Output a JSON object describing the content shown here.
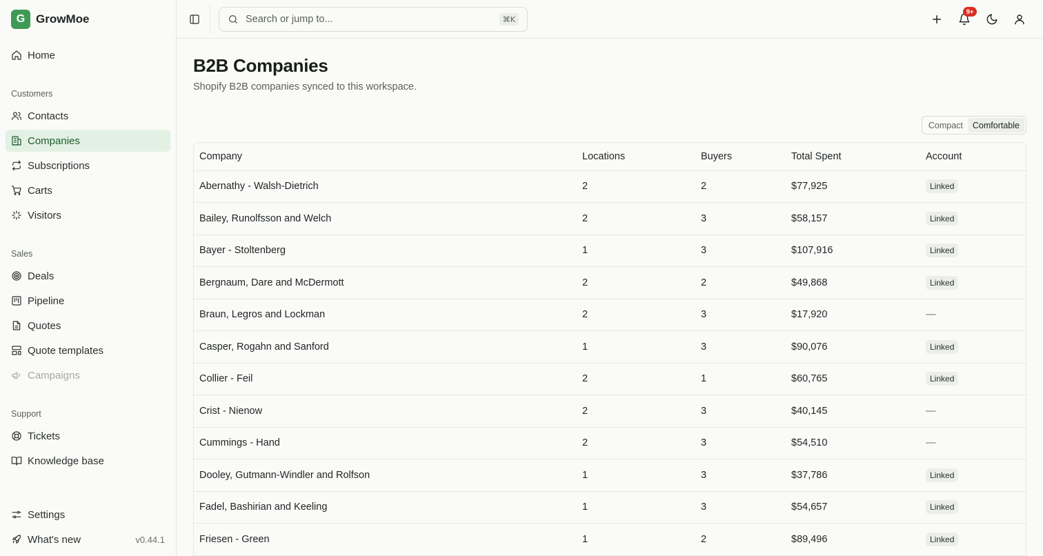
{
  "app": {
    "name": "GrowMoe",
    "logo_letter": "G",
    "version": "v0.44.1"
  },
  "sidebar": {
    "home": "Home",
    "sections": [
      {
        "label": "Customers",
        "items": [
          "Contacts",
          "Companies",
          "Subscriptions",
          "Carts",
          "Visitors"
        ]
      },
      {
        "label": "Sales",
        "items": [
          "Deals",
          "Pipeline",
          "Quotes",
          "Quote templates",
          "Campaigns"
        ]
      },
      {
        "label": "Support",
        "items": [
          "Tickets",
          "Knowledge base"
        ]
      }
    ],
    "active": "Companies",
    "footer": {
      "settings": "Settings",
      "whats_new": "What's new"
    }
  },
  "topbar": {
    "search_placeholder": "Search or jump to...",
    "search_shortcut": "⌘K",
    "notification_badge": "9+"
  },
  "page": {
    "title": "B2B Companies",
    "subtitle": "Shopify B2B companies synced to this workspace.",
    "density_options": [
      "Compact",
      "Comfortable"
    ],
    "density_selected": "Comfortable"
  },
  "table": {
    "columns": [
      "Company",
      "Locations",
      "Buyers",
      "Total Spent",
      "Account"
    ],
    "rows": [
      [
        "Abernathy - Walsh-Dietrich",
        "2",
        "2",
        "$77,925",
        "Linked"
      ],
      [
        "Bailey, Runolfsson and Welch",
        "2",
        "3",
        "$58,157",
        "Linked"
      ],
      [
        "Bayer - Stoltenberg",
        "1",
        "3",
        "$107,916",
        "Linked"
      ],
      [
        "Bergnaum, Dare and McDermott",
        "2",
        "2",
        "$49,868",
        "Linked"
      ],
      [
        "Braun, Legros and Lockman",
        "2",
        "3",
        "$17,920",
        "—"
      ],
      [
        "Casper, Rogahn and Sanford",
        "1",
        "3",
        "$90,076",
        "Linked"
      ],
      [
        "Collier - Feil",
        "2",
        "1",
        "$60,765",
        "Linked"
      ],
      [
        "Crist - Nienow",
        "2",
        "3",
        "$40,145",
        "—"
      ],
      [
        "Cummings - Hand",
        "2",
        "3",
        "$54,510",
        "—"
      ],
      [
        "Dooley, Gutmann-Windler and Rolfson",
        "1",
        "3",
        "$37,786",
        "Linked"
      ],
      [
        "Fadel, Bashirian and Keeling",
        "1",
        "3",
        "$54,657",
        "Linked"
      ],
      [
        "Friesen - Green",
        "1",
        "2",
        "$89,496",
        "Linked"
      ]
    ]
  }
}
